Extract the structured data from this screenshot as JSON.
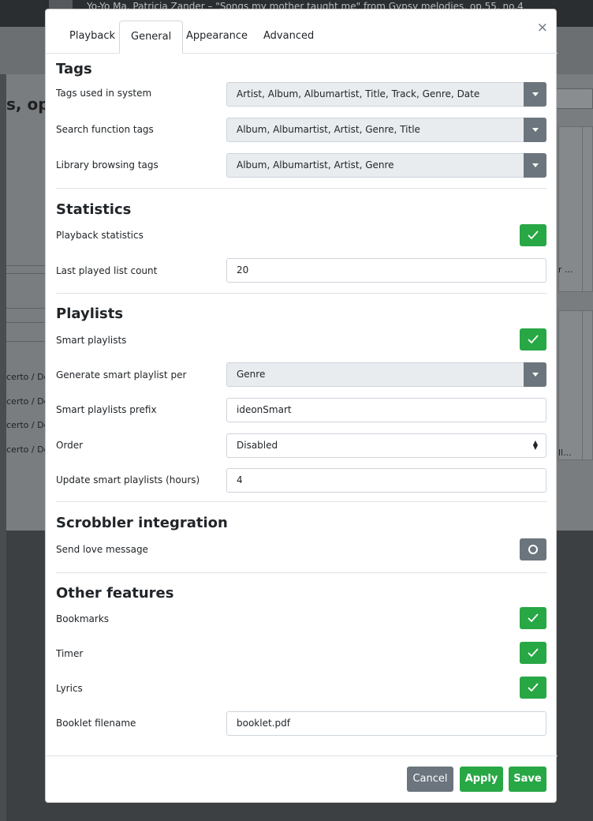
{
  "background": {
    "now_playing": "Yo-Yo Ma, Patricia Zander – \"Songs my mother taught me\" from Gypsy melodies, op.55, no.4",
    "heading": "s, op",
    "rows": [
      "certo / Do",
      "certo / Do",
      "certo / Do",
      "certo / Do"
    ],
    "card_text_1": "r ...",
    "card_text_2": "ll..."
  },
  "modal": {
    "tabs": [
      {
        "label": "Playback"
      },
      {
        "label": "General"
      },
      {
        "label": "Appearance"
      },
      {
        "label": "Advanced"
      }
    ],
    "active_tab": "General",
    "close_glyph": "×",
    "sections": {
      "tags": {
        "title": "Tags",
        "tags_used_label": "Tags used in system",
        "tags_used_value": "Artist, Album, Albumartist, Title, Track, Genre, Date",
        "search_tags_label": "Search function tags",
        "search_tags_value": "Album, Albumartist, Artist, Genre, Title",
        "browse_tags_label": "Library browsing tags",
        "browse_tags_value": "Album, Albumartist, Artist, Genre"
      },
      "statistics": {
        "title": "Statistics",
        "playback_stats_label": "Playback statistics",
        "playback_stats_checked": true,
        "last_played_label": "Last played list count",
        "last_played_value": "20"
      },
      "playlists": {
        "title": "Playlists",
        "smart_label": "Smart playlists",
        "smart_checked": true,
        "generate_label": "Generate smart playlist per",
        "generate_value": "Genre",
        "prefix_label": "Smart playlists prefix",
        "prefix_value": "ideonSmart",
        "order_label": "Order",
        "order_value": "Disabled",
        "update_label": "Update smart playlists (hours)",
        "update_value": "4"
      },
      "scrobbler": {
        "title": "Scrobbler integration",
        "love_label": "Send love message",
        "love_checked": false
      },
      "other": {
        "title": "Other features",
        "bookmarks_label": "Bookmarks",
        "bookmarks_checked": true,
        "timer_label": "Timer",
        "timer_checked": true,
        "lyrics_label": "Lyrics",
        "lyrics_checked": true,
        "booklet_label": "Booklet filename",
        "booklet_value": "booklet.pdf"
      }
    },
    "buttons": {
      "cancel": "Cancel",
      "apply": "Apply",
      "save": "Save"
    },
    "colors": {
      "success": "#28a745",
      "secondary": "#6c757d",
      "select_bg": "#e9ecef"
    }
  }
}
